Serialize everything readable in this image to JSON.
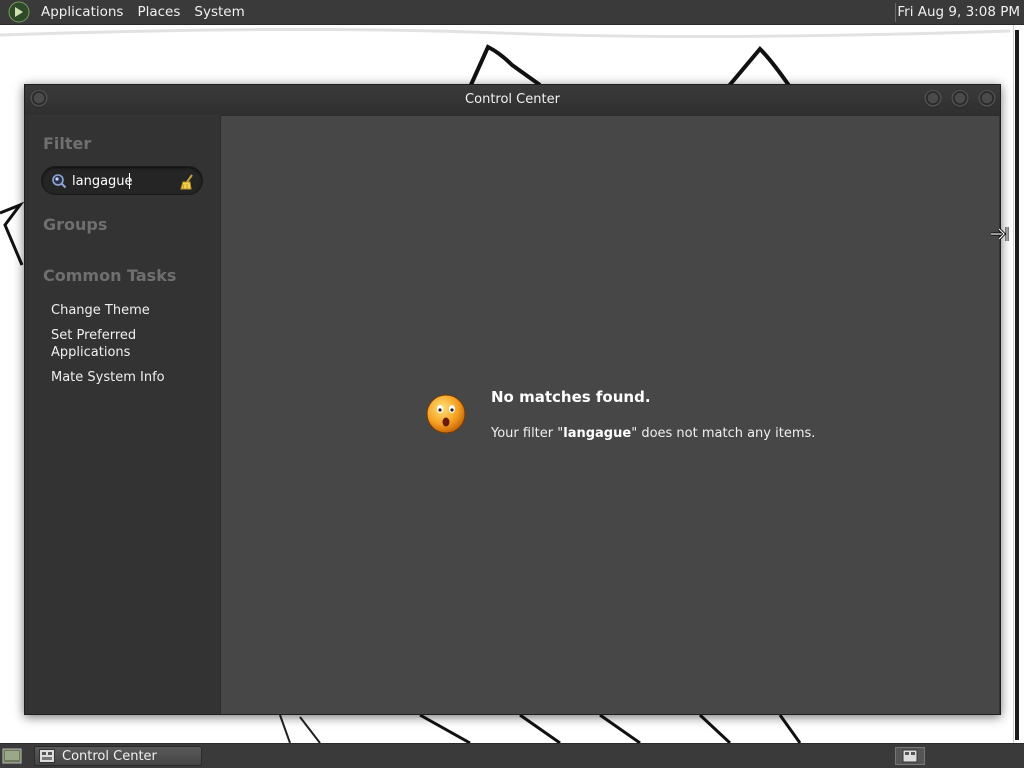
{
  "top_panel": {
    "menus": [
      "Applications",
      "Places",
      "System"
    ],
    "clock": "Fri Aug  9,  3:08 PM"
  },
  "window": {
    "title": "Control Center"
  },
  "sidebar": {
    "filter_heading": "Filter",
    "search": {
      "value": "langague",
      "placeholder": ""
    },
    "groups_heading": "Groups",
    "common_tasks_heading": "Common Tasks",
    "tasks": [
      "Change Theme",
      "Set Preferred Applications",
      "Mate System Info"
    ]
  },
  "content": {
    "no_match_title": "No matches found.",
    "message_prefix": "Your filter \"",
    "message_term": "langague",
    "message_suffix": "\" does not match any items."
  },
  "taskbar": {
    "task_label": "Control Center"
  },
  "colors": {
    "panel_bg": "#3a3a3a",
    "window_bg": "#333333",
    "content_bg": "#474747",
    "heading_color": "#6f6f6f"
  }
}
